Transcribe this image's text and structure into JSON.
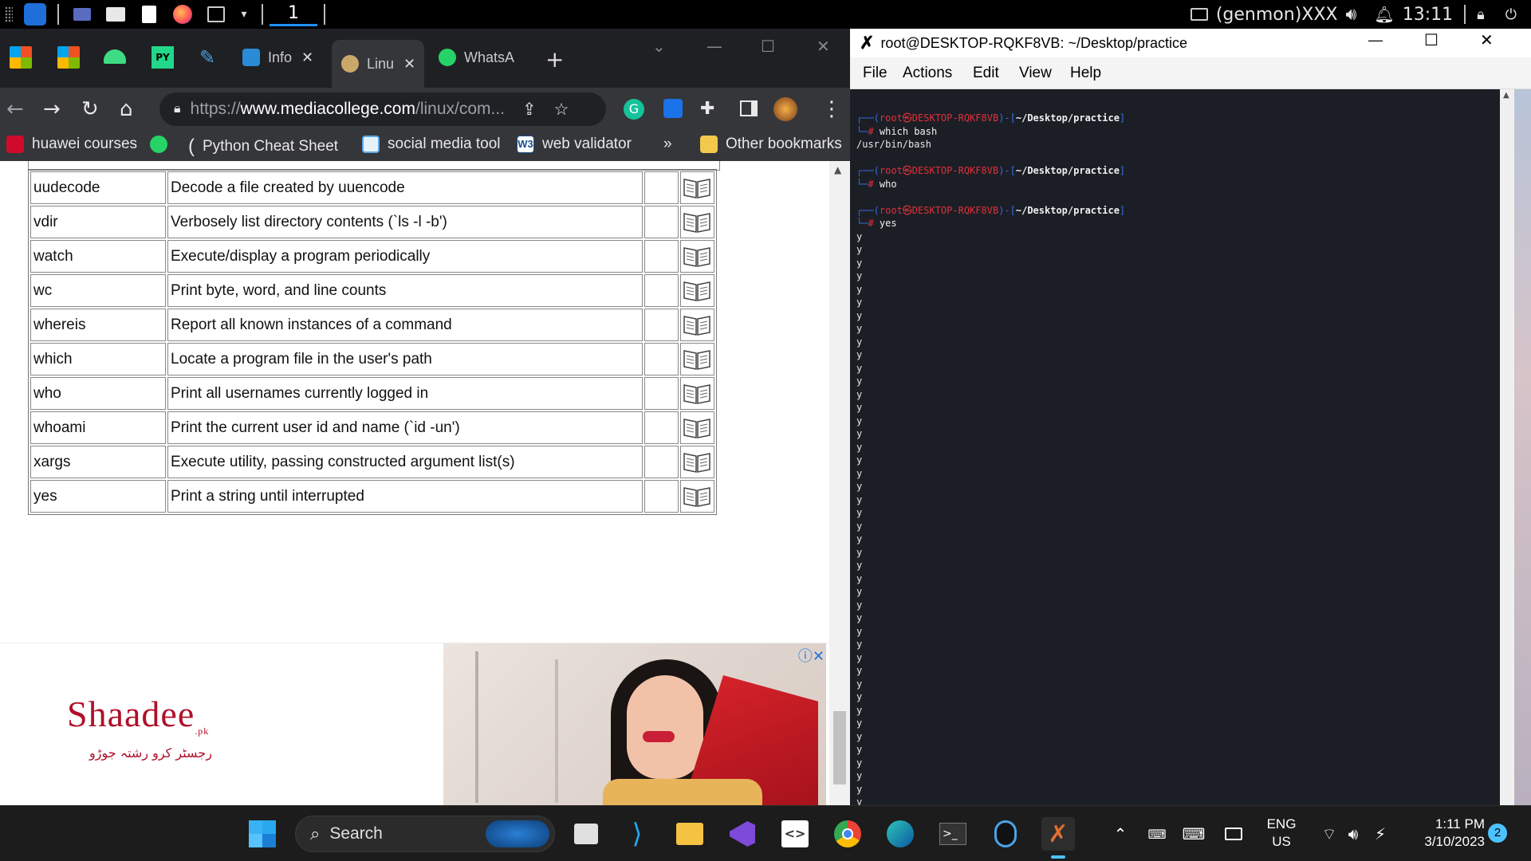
{
  "xfce_panel": {
    "workspace": "1",
    "genmon": "(genmon)XXX",
    "clock": "13:11"
  },
  "chrome": {
    "tabs": [
      {
        "label": "Info",
        "color": "#2a8bd6"
      },
      {
        "label": "Linu",
        "color": "#c9a86a"
      },
      {
        "label": "WhatsA",
        "color": "#25d366"
      }
    ],
    "url_scheme": "https://",
    "url_host": "www.mediacollege.com",
    "url_path": "/linux/com...",
    "bookmarks": [
      {
        "label": "huawei courses",
        "color": "#cf0a2c"
      },
      {
        "label": "",
        "color": "#25d366"
      },
      {
        "label": "Python Cheat Sheet",
        "color": "#ffffff"
      },
      {
        "label": "social media tool",
        "color": "#5aa9e6"
      },
      {
        "label": "web validator",
        "color": "#ffffff"
      }
    ],
    "bookmarks_more": "»",
    "other_bookmarks": "Other bookmarks",
    "table_rows": [
      {
        "cmd": "uudecode",
        "desc": "Decode a file created by uuencode"
      },
      {
        "cmd": "vdir",
        "desc": "Verbosely list directory contents (`ls -l -b')"
      },
      {
        "cmd": "watch",
        "desc": "Execute/display a program periodically"
      },
      {
        "cmd": "wc",
        "desc": "Print byte, word, and line counts"
      },
      {
        "cmd": "whereis",
        "desc": "Report all known instances of a command"
      },
      {
        "cmd": "which",
        "desc": "Locate a program file in the user's path"
      },
      {
        "cmd": "who",
        "desc": "Print all usernames currently logged in"
      },
      {
        "cmd": "whoami",
        "desc": "Print the current user id and name (`id -un')"
      },
      {
        "cmd": "xargs",
        "desc": "Execute utility, passing constructed argument list(s)"
      },
      {
        "cmd": "yes",
        "desc": "Print a string until interrupted"
      }
    ],
    "ad": {
      "logo": "Shaadee",
      "logo_suffix": ".pk",
      "tagline": "رجسٹر کرو رشتہ جوڑو"
    }
  },
  "terminal": {
    "title": "root@DESKTOP-RQKF8VB: ~/Desktop/practice",
    "menu": [
      "File",
      "Actions",
      "Edit",
      "View",
      "Help"
    ],
    "user_host": "root㉿DESKTOP-RQKF8VB",
    "cwd": "~/Desktop/practice",
    "commands": [
      {
        "cmd": "which bash",
        "output": [
          "/usr/bin/bash"
        ]
      },
      {
        "cmd": "who",
        "output": []
      },
      {
        "cmd": "yes",
        "output": []
      }
    ],
    "yes_char": "y",
    "yes_count": 44
  },
  "taskbar": {
    "search_placeholder": "Search",
    "lang": "ENG",
    "region": "US",
    "time": "1:11 PM",
    "date": "3/10/2023",
    "notif_count": "2"
  }
}
